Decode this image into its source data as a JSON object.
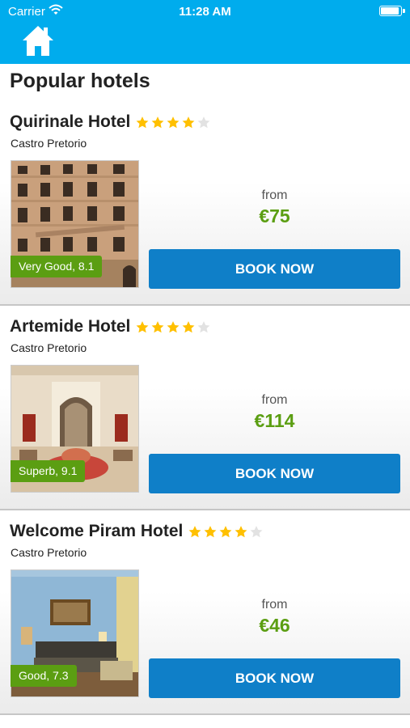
{
  "status_bar": {
    "carrier": "Carrier",
    "time": "11:28 AM",
    "battery_level": 0.95
  },
  "header": {
    "icon": "home-icon",
    "background": "#00aced"
  },
  "page_title": "Popular hotels",
  "colors": {
    "accent": "#00aced",
    "button": "#0f7fc8",
    "price": "#5b9e12",
    "star_on": "#ffc000",
    "star_off": "#e2e2e2"
  },
  "hotels": [
    {
      "name": "Quirinale Hotel",
      "stars": 4,
      "max_stars": 5,
      "district": "Castro Pretorio",
      "score": "Very Good, 8.1",
      "from_label": "from",
      "price": "€75",
      "book_label": "BOOK NOW"
    },
    {
      "name": "Artemide Hotel",
      "stars": 4,
      "max_stars": 5,
      "district": "Castro Pretorio",
      "score": "Superb, 9.1",
      "from_label": "from",
      "price": "€114",
      "book_label": "BOOK NOW"
    },
    {
      "name": "Welcome Piram Hotel",
      "stars": 4,
      "max_stars": 5,
      "district": "Castro Pretorio",
      "score": "Good, 7.3",
      "from_label": "from",
      "price": "€46",
      "book_label": "BOOK NOW"
    }
  ]
}
